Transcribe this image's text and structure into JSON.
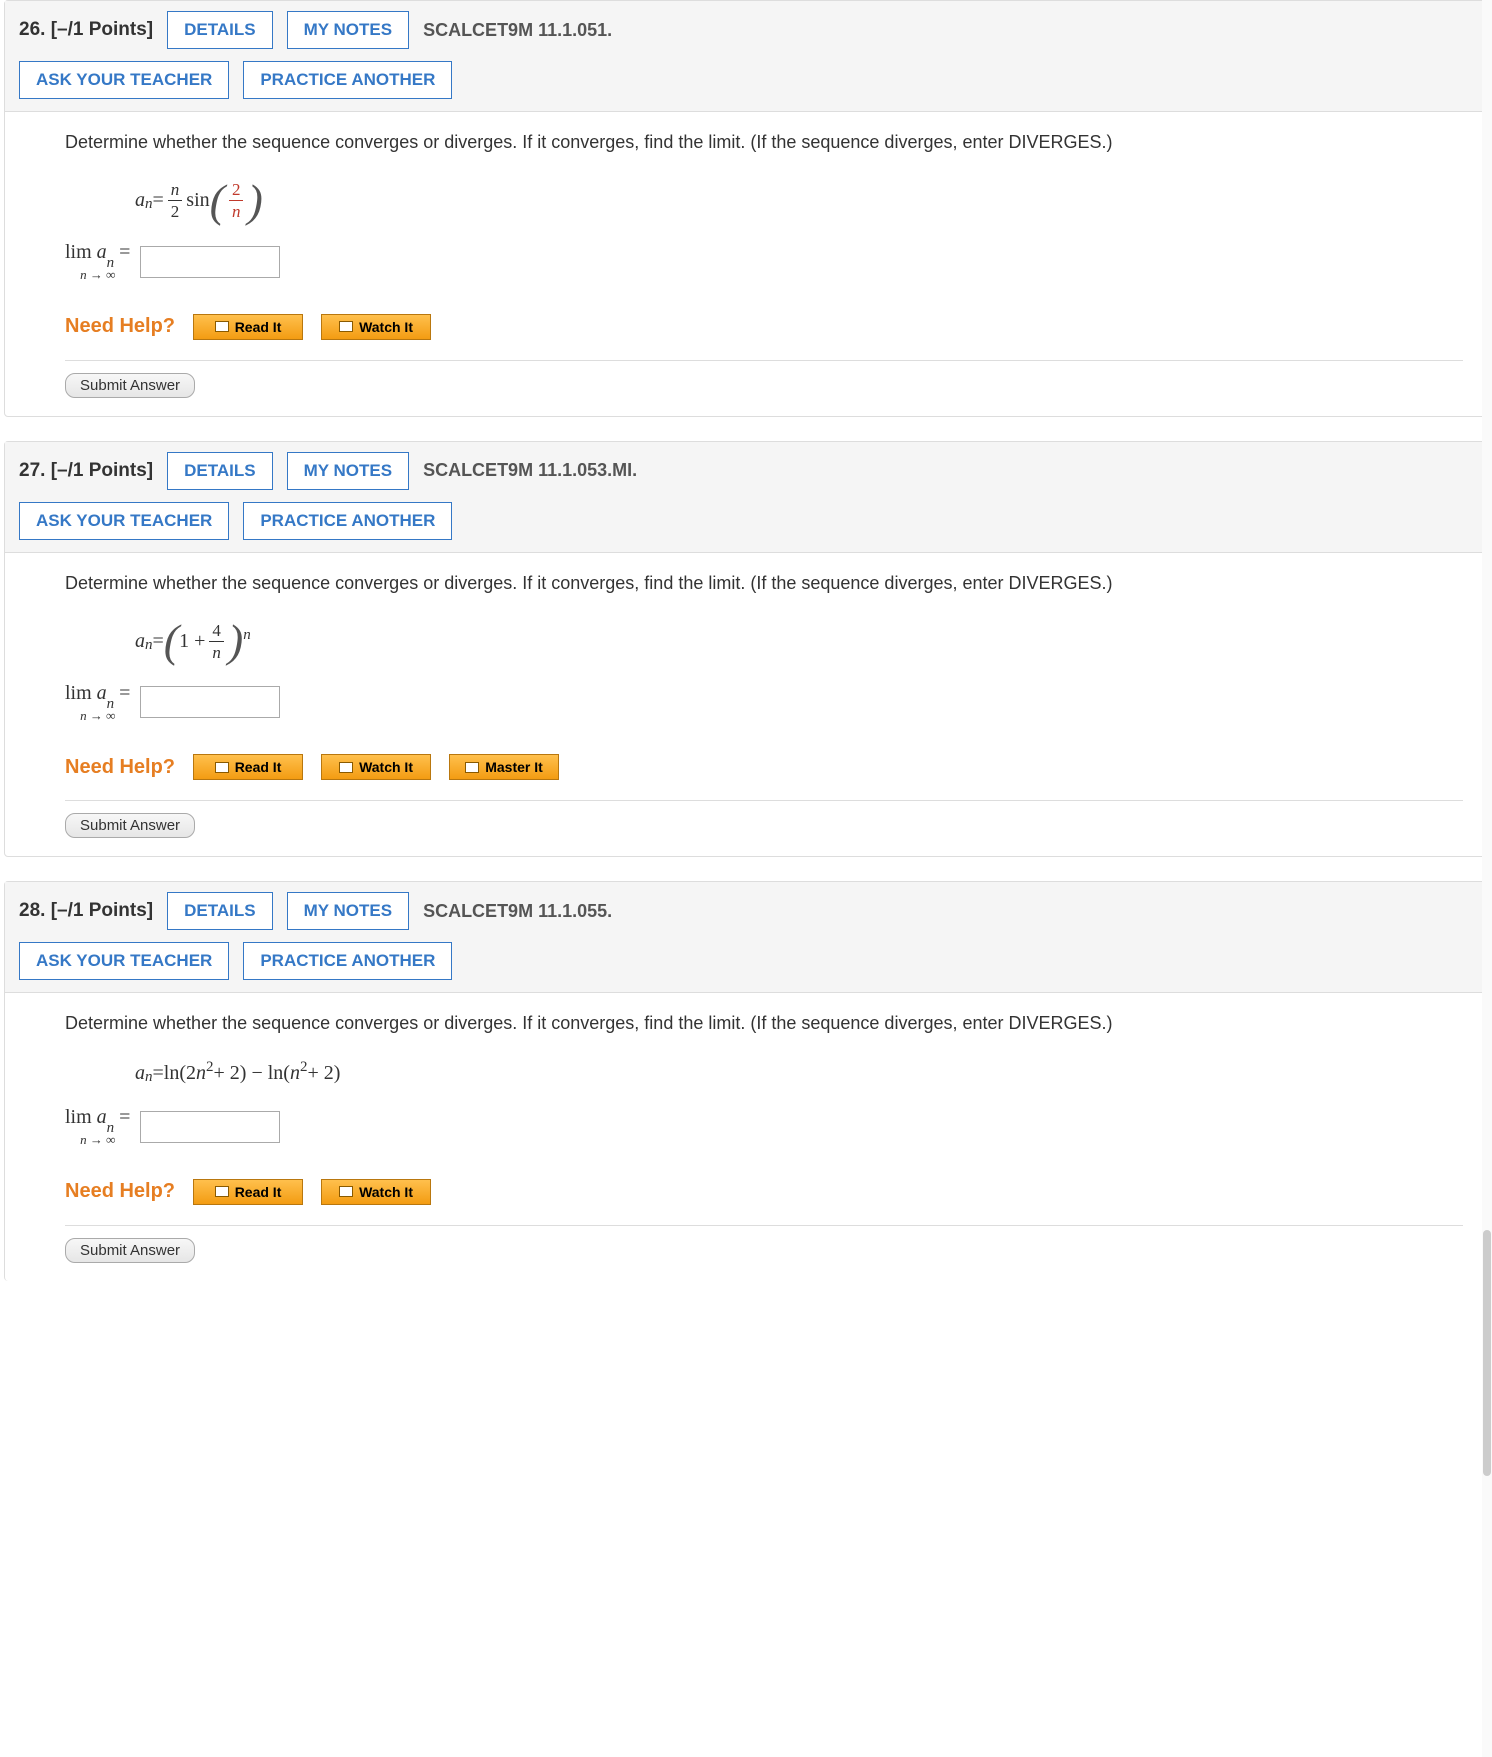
{
  "questions": [
    {
      "number": "26.",
      "points": "[–/1 Points]",
      "buttons": {
        "details": "DETAILS",
        "mynotes": "MY NOTES",
        "ask": "ASK YOUR TEACHER",
        "practice": "PRACTICE ANOTHER"
      },
      "refcode": "SCALCET9M 11.1.051.",
      "prompt": "Determine whether the sequence converges or diverges. If it converges, find the limit. (If the sequence diverges, enter DIVERGES.)",
      "formula": {
        "lhs_a": "a",
        "lhs_sub": "n",
        "eq": " = ",
        "f1_num": "n",
        "f1_den": "2",
        "sin": " sin",
        "f2_num": "2",
        "f2_den": "n"
      },
      "limit": {
        "lim": "lim",
        "under": "n → ∞",
        "a": " a",
        "sub": "n",
        "eq": " = "
      },
      "need_help": "Need Help?",
      "help_buttons": [
        "Read It",
        "Watch It"
      ],
      "submit": "Submit Answer"
    },
    {
      "number": "27.",
      "points": "[–/1 Points]",
      "buttons": {
        "details": "DETAILS",
        "mynotes": "MY NOTES",
        "ask": "ASK YOUR TEACHER",
        "practice": "PRACTICE ANOTHER"
      },
      "refcode": "SCALCET9M 11.1.053.MI.",
      "prompt": "Determine whether the sequence converges or diverges. If it converges, find the limit. (If the sequence diverges, enter DIVERGES.)",
      "formula": {
        "lhs_a": "a",
        "lhs_sub": "n",
        "eq": " = ",
        "one_plus": "1 + ",
        "f_num": "4",
        "f_den": "n",
        "exp": "n"
      },
      "limit": {
        "lim": "lim",
        "under": "n → ∞",
        "a": " a",
        "sub": "n",
        "eq": " = "
      },
      "need_help": "Need Help?",
      "help_buttons": [
        "Read It",
        "Watch It",
        "Master It"
      ],
      "submit": "Submit Answer"
    },
    {
      "number": "28.",
      "points": "[–/1 Points]",
      "buttons": {
        "details": "DETAILS",
        "mynotes": "MY NOTES",
        "ask": "ASK YOUR TEACHER",
        "practice": "PRACTICE ANOTHER"
      },
      "refcode": "SCALCET9M 11.1.055.",
      "prompt": "Determine whether the sequence converges or diverges. If it converges, find the limit. (If the sequence diverges, enter DIVERGES.)",
      "formula": {
        "lhs_a": "a",
        "lhs_sub": "n",
        "eq": " = ",
        "body_pre": "ln(2",
        "body_n1": "n",
        "body_sup1": "2",
        "body_mid": " + 2) − ln(",
        "body_n2": "n",
        "body_sup2": "2",
        "body_post": " + 2)"
      },
      "limit": {
        "lim": "lim",
        "under": "n → ∞",
        "a": " a",
        "sub": "n",
        "eq": " = "
      },
      "need_help": "Need Help?",
      "help_buttons": [
        "Read It",
        "Watch It"
      ],
      "submit": "Submit Answer"
    }
  ]
}
